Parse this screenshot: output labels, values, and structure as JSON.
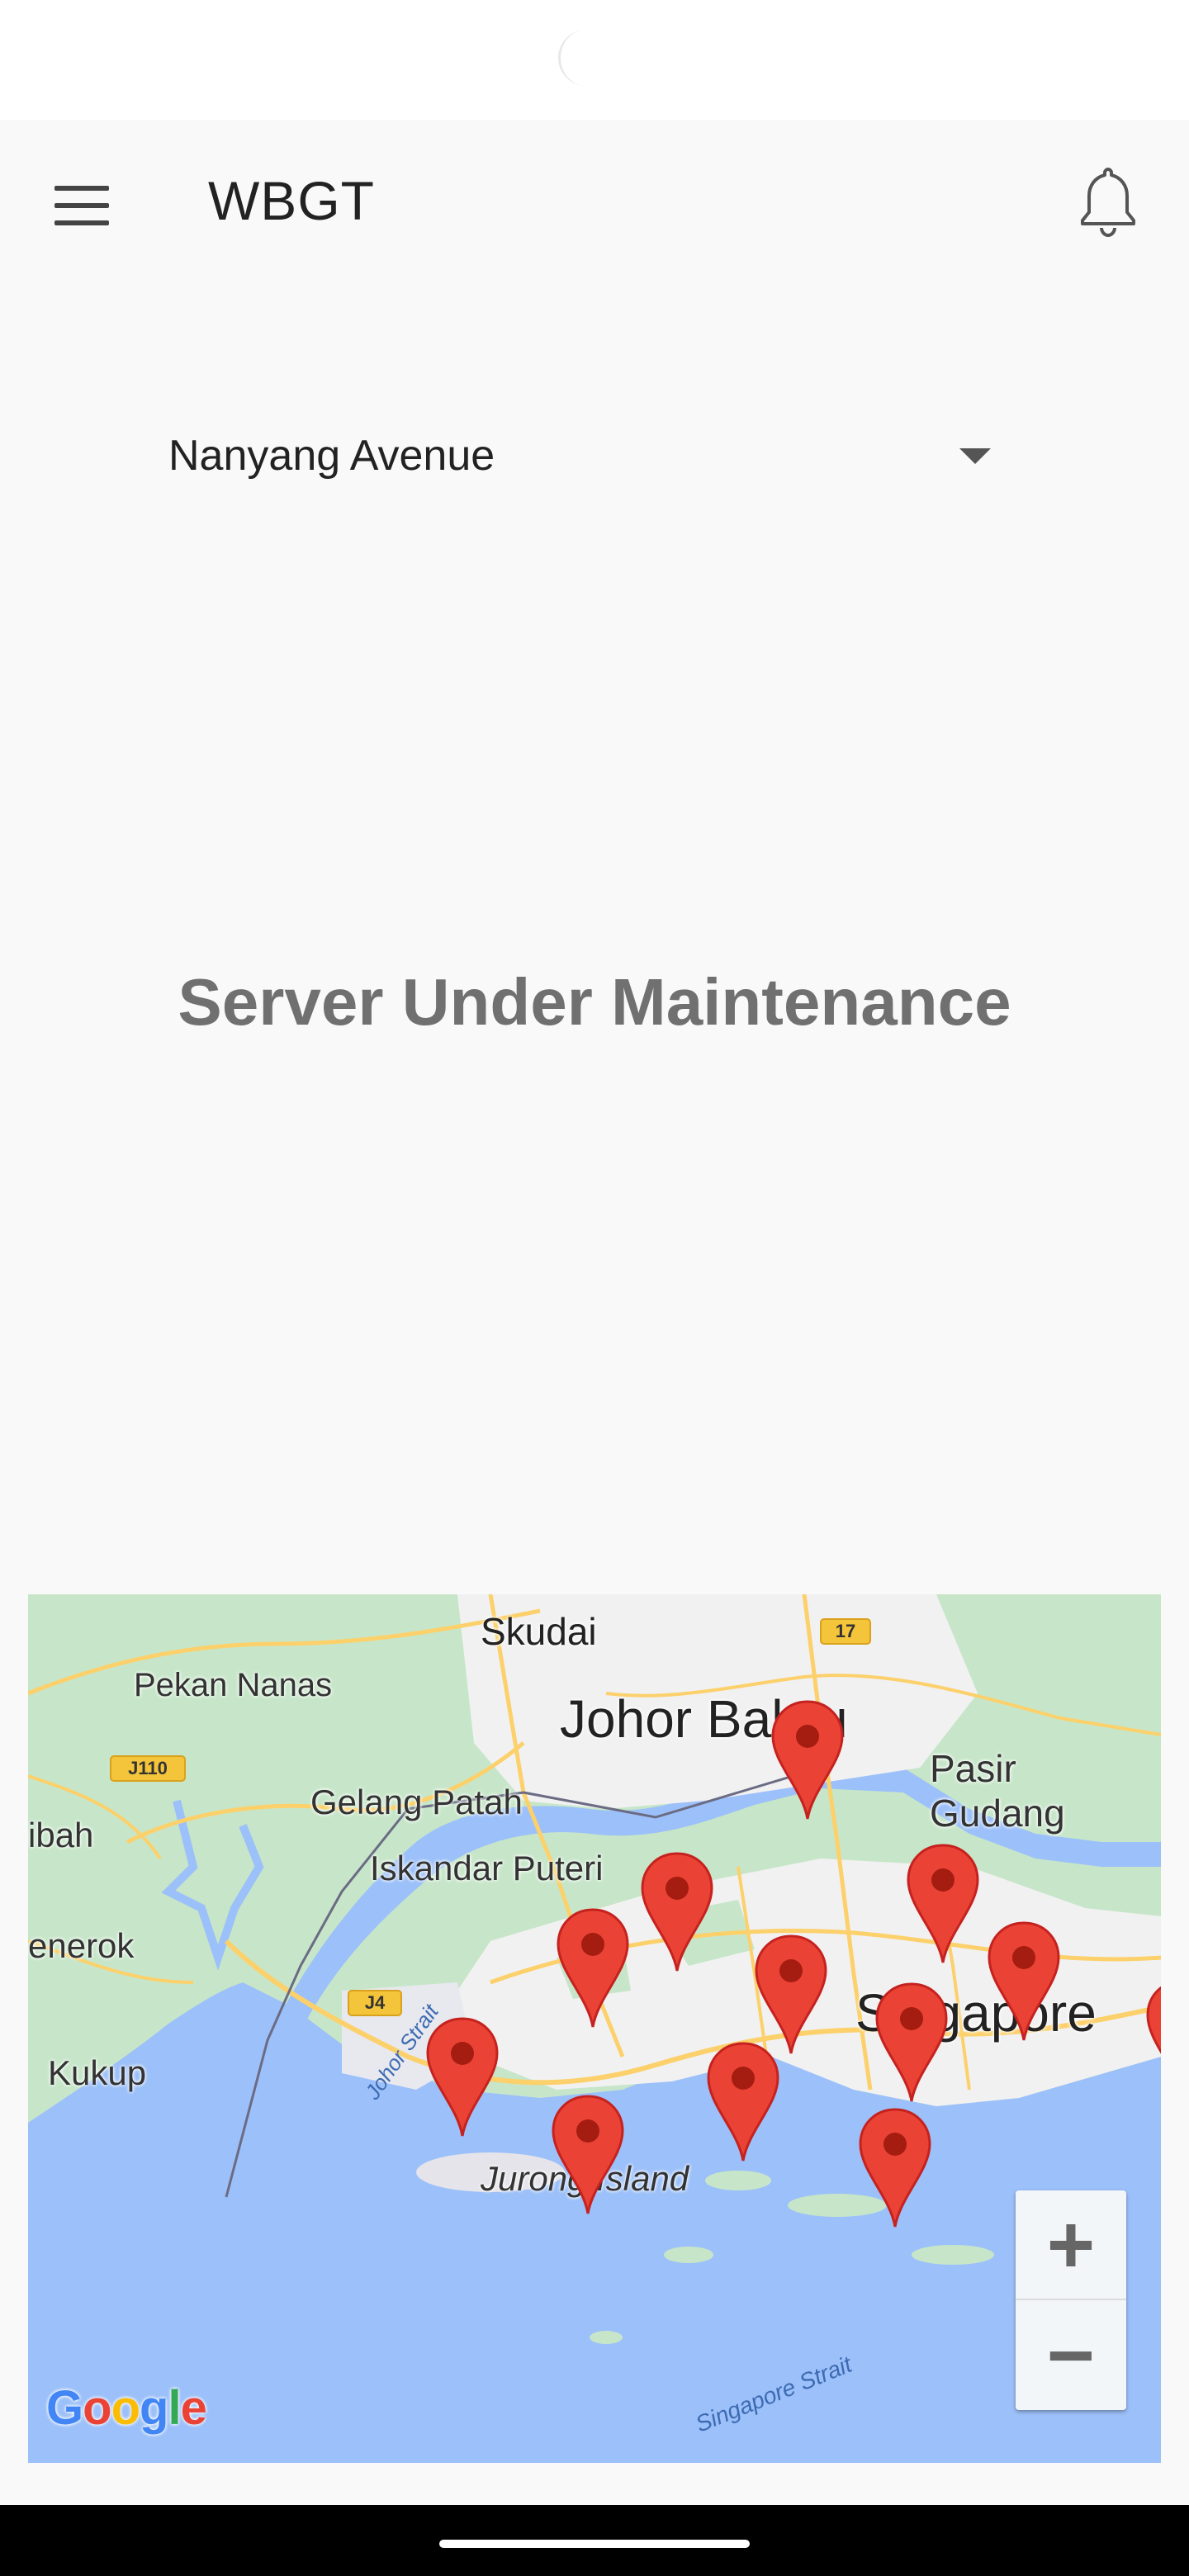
{
  "app_bar": {
    "title": "WBGT",
    "menu_icon": "hamburger-menu-icon",
    "bell_icon": "bell-outline-icon"
  },
  "location": {
    "selected": "Nanyang Avenue"
  },
  "status": {
    "message": "Server Under Maintenance"
  },
  "map": {
    "labels": {
      "skudai": "Skudai",
      "johor_bahru": "Johor Bahru",
      "pekan_nanas": "Pekan Nanas",
      "pasir_gudang": "Pasir Gudang",
      "gelang_patah": "Gelang Patah",
      "iskandar_puteri": "Iskandar Puteri",
      "rambah": "ibah",
      "serkat": "enerok",
      "kukup": "Kukup",
      "singapore": "Singapore",
      "jurong_island": "Jurong Island",
      "johor_strait": "Johor Strait",
      "singapore_strait": "Singapore Strait",
      "shield_17": "17",
      "shield_j110": "J110",
      "shield_j4": "J4"
    },
    "zoom_in_label": "+",
    "zoom_out_label": "−",
    "attribution": "Google",
    "marker_count": 12
  },
  "colors": {
    "marker": "#ea4335",
    "marker_dot": "#a51c10",
    "water": "#9cc0f9",
    "land": "#c7e6c9",
    "urban": "#f1f1f1",
    "road": "#fcd06a"
  }
}
